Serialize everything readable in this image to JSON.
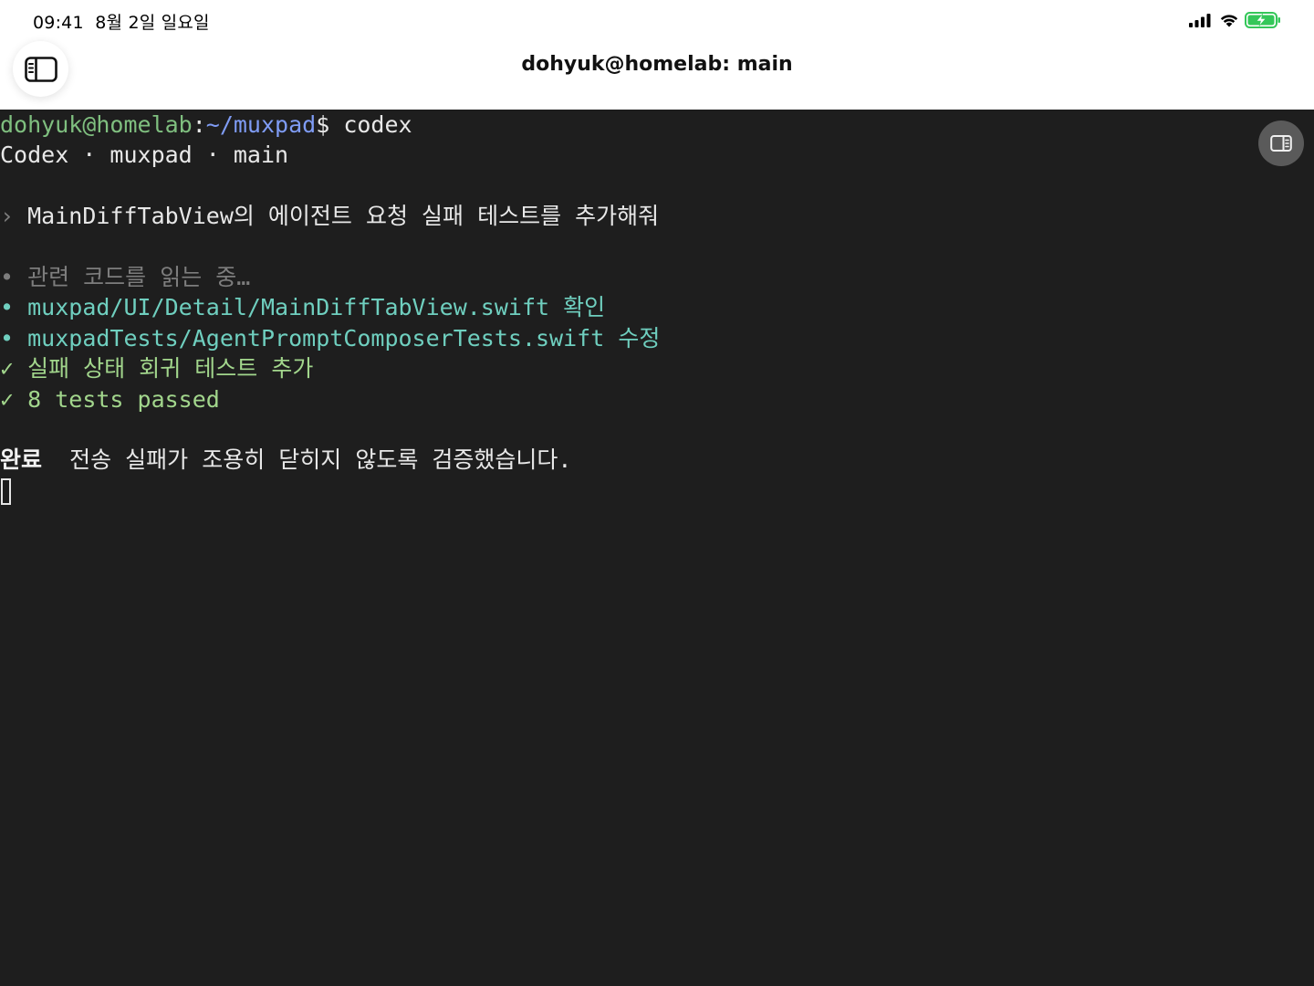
{
  "status_bar": {
    "time": "09:41",
    "date": "8월 2일 일요일",
    "battery_color": "#34c759"
  },
  "nav": {
    "title": "dohyuk@homelab: main"
  },
  "terminal": {
    "prompt": {
      "user_host": "dohyuk@homelab",
      "colon": ":",
      "path": "~/muxpad",
      "dollar": "$",
      "command": " codex"
    },
    "header": "Codex · muxpad · main",
    "user_message": {
      "marker": "›",
      "text": " MainDiffTabView의 에이전트 요청 실패 테스트를 추가해줘"
    },
    "steps": [
      {
        "marker": "•",
        "text": " 관련 코드를 읽는 중…",
        "style": "dim"
      },
      {
        "marker": "•",
        "text": " muxpad/UI/Detail/MainDiffTabView.swift 확인",
        "style": "teal"
      },
      {
        "marker": "•",
        "text": " muxpadTests/AgentPromptComposerTests.swift 수정",
        "style": "teal"
      },
      {
        "marker": "✓",
        "text": " 실패 상태 회귀 테스트 추가",
        "style": "check"
      },
      {
        "marker": "✓",
        "text": " 8 tests passed",
        "style": "check"
      }
    ],
    "summary": {
      "label": "완료",
      "text": "  전송 실패가 조용히 닫히지 않도록 검증했습니다."
    }
  }
}
